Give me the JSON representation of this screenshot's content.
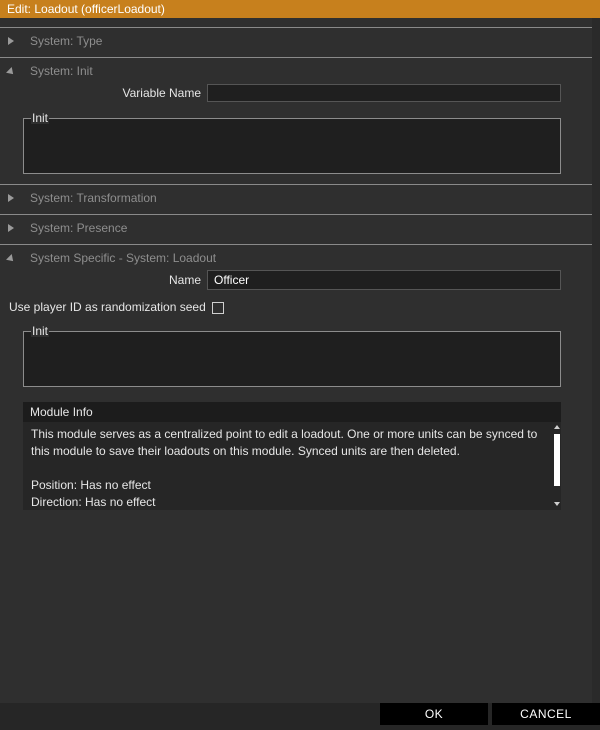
{
  "window": {
    "title": "Edit: Loadout (officerLoadout)"
  },
  "sections": {
    "type": {
      "label": "System: Type"
    },
    "init": {
      "label": "System: Init",
      "variable_name_label": "Variable Name",
      "variable_name_value": "",
      "init_group_label": "Init"
    },
    "transformation": {
      "label": "System: Transformation"
    },
    "presence": {
      "label": "System: Presence"
    },
    "loadout": {
      "label": "System Specific - System: Loadout",
      "name_label": "Name",
      "name_value": "Officer",
      "seed_label": "Use player ID as randomization seed",
      "init_group_label": "Init"
    }
  },
  "module_info": {
    "header": "Module Info",
    "body": "This module serves as a centralized point to edit a loadout. One or more units can be synced to this module to save their loadouts on this module. Synced units are then deleted.\n\nPosition: Has no effect\nDirection: Has no effect"
  },
  "buttons": {
    "ok": "OK",
    "cancel": "CANCEL"
  }
}
